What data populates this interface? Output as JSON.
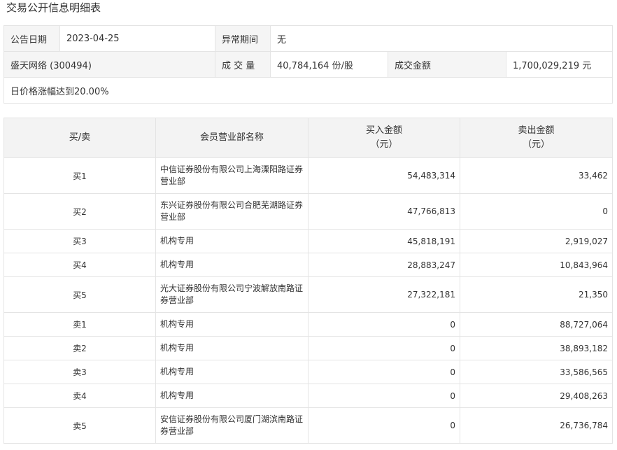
{
  "title": "交易公开信息明细表",
  "info": {
    "announce_date_label": "公告日期",
    "announce_date": "2023-04-25",
    "abnormal_period_label": "异常期间",
    "abnormal_period": "无",
    "stock": "盛天网络 (300494)",
    "volume_label": "成 交 量",
    "volume": "40,784,164 份/股",
    "turnover_label": "成交金额",
    "turnover": "1,700,029,219 元",
    "reason": "日价格涨幅达到20.00%"
  },
  "detail": {
    "headers": {
      "side": "买/卖",
      "name": "会员营业部名称",
      "buy": "买入金额",
      "buy_unit": "（元）",
      "sell": "卖出金额",
      "sell_unit": "（元）"
    },
    "rows": [
      {
        "side": "买1",
        "name": "中信证券股份有限公司上海溧阳路证券营业部",
        "buy": "54,483,314",
        "sell": "33,462"
      },
      {
        "side": "买2",
        "name": "东兴证券股份有限公司合肥芜湖路证券营业部",
        "buy": "47,766,813",
        "sell": "0"
      },
      {
        "side": "买3",
        "name": "机构专用",
        "buy": "45,818,191",
        "sell": "2,919,027"
      },
      {
        "side": "买4",
        "name": "机构专用",
        "buy": "28,883,247",
        "sell": "10,843,964"
      },
      {
        "side": "买5",
        "name": "光大证券股份有限公司宁波解放南路证券营业部",
        "buy": "27,322,181",
        "sell": "21,350"
      },
      {
        "side": "卖1",
        "name": "机构专用",
        "buy": "0",
        "sell": "88,727,064"
      },
      {
        "side": "卖2",
        "name": "机构专用",
        "buy": "0",
        "sell": "38,893,182"
      },
      {
        "side": "卖3",
        "name": "机构专用",
        "buy": "0",
        "sell": "33,586,565"
      },
      {
        "side": "卖4",
        "name": "机构专用",
        "buy": "0",
        "sell": "29,408,263"
      },
      {
        "side": "卖5",
        "name": "安信证券股份有限公司厦门湖滨南路证券营业部",
        "buy": "0",
        "sell": "26,736,784"
      }
    ]
  }
}
